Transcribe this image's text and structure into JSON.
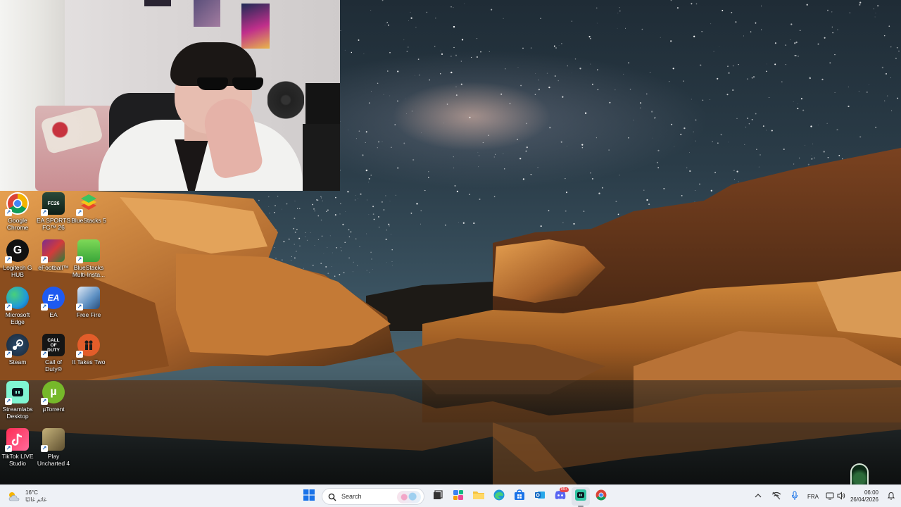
{
  "desktop": {
    "icons": [
      {
        "label": "Google Chrome",
        "icon": "chrome-icon",
        "color": "#ffffff"
      },
      {
        "label": "EA SPORTS FC™ 26",
        "icon": "ea-sports-fc-icon",
        "color": "#1c3d2d"
      },
      {
        "label": "BlueStacks 5",
        "icon": "bluestacks-icon",
        "color": "#3cc35f"
      },
      {
        "label": "Logitech G HUB",
        "icon": "logitech-g-icon",
        "color": "#111111"
      },
      {
        "label": "eFootball™",
        "icon": "efootball-icon",
        "color": "#7b2d8e"
      },
      {
        "label": "BlueStacks Multi-Insta...",
        "icon": "bluestacks-multi-icon",
        "color": "#53c24a"
      },
      {
        "label": "Microsoft Edge",
        "icon": "edge-icon",
        "color": "#1f9ad9"
      },
      {
        "label": "EA",
        "icon": "ea-icon",
        "color": "#ff4747"
      },
      {
        "label": "Free Fire",
        "icon": "free-fire-icon",
        "color": "#5c8fc2"
      },
      {
        "label": "Steam",
        "icon": "steam-icon",
        "color": "#1b2838"
      },
      {
        "label": "Call of Duty®",
        "icon": "call-of-duty-icon",
        "color": "#151515"
      },
      {
        "label": "It Takes Two",
        "icon": "it-takes-two-icon",
        "color": "#e35d2a"
      },
      {
        "label": "Streamlabs Desktop",
        "icon": "streamlabs-icon",
        "color": "#80f5d2"
      },
      {
        "label": "µTorrent",
        "icon": "utorrent-icon",
        "color": "#76b82a"
      },
      {
        "label": "TikTok LIVE Studio",
        "icon": "tiktok-live-icon",
        "color": "#fe2c55"
      },
      {
        "label": "Play Uncharted 4",
        "icon": "uncharted-icon",
        "color": "#8c7a4a"
      }
    ]
  },
  "taskbar": {
    "weather": {
      "temp": "16°C",
      "desc": "غائم غالبًا",
      "icon": "cloudy-sun-icon"
    },
    "search": {
      "placeholder": "Search"
    },
    "apps": [
      {
        "name": "start-button",
        "icon": "windows-logo-icon"
      },
      {
        "name": "task-view",
        "icon": "task-view-icon"
      },
      {
        "name": "widgets",
        "icon": "widgets-icon"
      },
      {
        "name": "file-explorer",
        "icon": "folder-icon"
      },
      {
        "name": "edge",
        "icon": "edge-icon"
      },
      {
        "name": "microsoft-store",
        "icon": "store-icon"
      },
      {
        "name": "outlook",
        "icon": "outlook-icon"
      },
      {
        "name": "discord",
        "icon": "discord-icon",
        "badge": "99+"
      },
      {
        "name": "streamlabs",
        "icon": "streamlabs-icon"
      },
      {
        "name": "chrome",
        "icon": "chrome-icon"
      }
    ],
    "tray": {
      "language": "FRA",
      "time": "06:00",
      "date": "26/04/2026"
    }
  },
  "colors": {
    "taskbar_bg": "#eef1f6",
    "accent": "#1a73e8"
  }
}
